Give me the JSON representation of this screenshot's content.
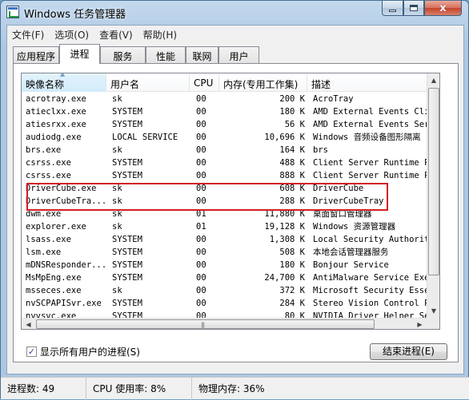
{
  "window": {
    "title": "Windows 任务管理器"
  },
  "title_buttons": {
    "minimize": "",
    "maximize": "",
    "close": "x"
  },
  "menu": [
    "文件(F)",
    "选项(O)",
    "查看(V)",
    "帮助(H)"
  ],
  "tabs": [
    "应用程序",
    "进程",
    "服务",
    "性能",
    "联网",
    "用户"
  ],
  "active_tab": "进程",
  "columns": [
    "映像名称",
    "用户名",
    "CPU",
    "内存(专用工作集)",
    "描述"
  ],
  "sorted_column": "映像名称",
  "processes": [
    {
      "name": "acrotray.exe",
      "user": "sk",
      "cpu": "00",
      "mem": "200 K",
      "desc": "AcroTray"
    },
    {
      "name": "atieclxx.exe",
      "user": "SYSTEM",
      "cpu": "00",
      "mem": "180 K",
      "desc": "AMD External Events Clie"
    },
    {
      "name": "atiesrxx.exe",
      "user": "SYSTEM",
      "cpu": "00",
      "mem": "56 K",
      "desc": "AMD External Events Serv"
    },
    {
      "name": "audiodg.exe",
      "user": "LOCAL SERVICE",
      "cpu": "00",
      "mem": "10,696 K",
      "desc": "Windows 音频设备图形隔离"
    },
    {
      "name": "brs.exe",
      "user": "sk",
      "cpu": "00",
      "mem": "164 K",
      "desc": "brs"
    },
    {
      "name": "csrss.exe",
      "user": "SYSTEM",
      "cpu": "00",
      "mem": "488 K",
      "desc": "Client Server Runtime Pr"
    },
    {
      "name": "csrss.exe",
      "user": "SYSTEM",
      "cpu": "00",
      "mem": "888 K",
      "desc": "Client Server Runtime Pr"
    },
    {
      "name": "DriverCube.exe",
      "user": "sk",
      "cpu": "00",
      "mem": "608 K",
      "desc": "DriverCube"
    },
    {
      "name": "DriverCubeTra...",
      "user": "sk",
      "cpu": "00",
      "mem": "288 K",
      "desc": "DriverCubeTray"
    },
    {
      "name": "dwm.exe",
      "user": "sk",
      "cpu": "01",
      "mem": "11,880 K",
      "desc": "桌面窗口管理器"
    },
    {
      "name": "explorer.exe",
      "user": "sk",
      "cpu": "01",
      "mem": "19,128 K",
      "desc": "Windows 资源管理器"
    },
    {
      "name": "lsass.exe",
      "user": "SYSTEM",
      "cpu": "00",
      "mem": "1,308 K",
      "desc": "Local Security Authority"
    },
    {
      "name": "lsm.exe",
      "user": "SYSTEM",
      "cpu": "00",
      "mem": "508 K",
      "desc": "本地会话管理器服务"
    },
    {
      "name": "mDNSResponder...",
      "user": "SYSTEM",
      "cpu": "00",
      "mem": "180 K",
      "desc": "Bonjour Service"
    },
    {
      "name": "MsMpEng.exe",
      "user": "SYSTEM",
      "cpu": "00",
      "mem": "24,700 K",
      "desc": "AntiMalware Service Exec"
    },
    {
      "name": "msseces.exe",
      "user": "sk",
      "cpu": "00",
      "mem": "372 K",
      "desc": "Microsoft Security Essen"
    },
    {
      "name": "nvSCPAPISvr.exe",
      "user": "SYSTEM",
      "cpu": "00",
      "mem": "284 K",
      "desc": "Stereo Vision Control Pa"
    },
    {
      "name": "nvvsvc.exe",
      "user": "SYSTEM",
      "cpu": "00",
      "mem": "80 K",
      "desc": "NVIDIA Driver Helper Ser"
    }
  ],
  "show_all_users": {
    "label": "显示所有用户的进程(S)",
    "checked": "✓"
  },
  "end_process_label": "结束进程(E)",
  "status": {
    "process_count": "进程数: 49",
    "cpu_usage": "CPU 使用率: 8%",
    "memory": "物理内存: 36%"
  },
  "highlight_color": "#d21f24"
}
